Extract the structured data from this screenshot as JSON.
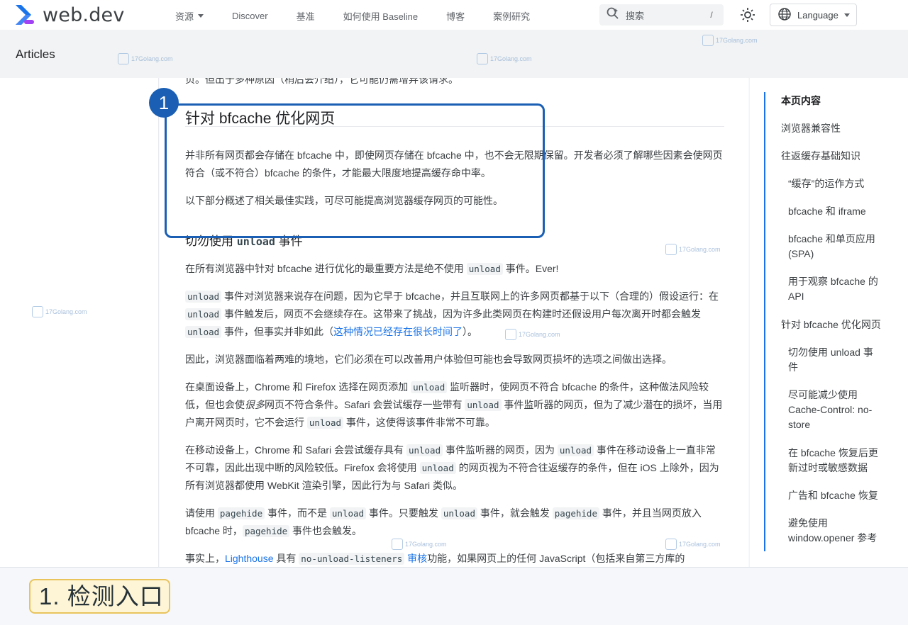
{
  "header": {
    "logo_text": "web.dev",
    "nav": [
      {
        "label": "资源",
        "has_dropdown": true
      },
      {
        "label": "Discover"
      },
      {
        "label": "基准"
      },
      {
        "label": "如何使用 Baseline"
      },
      {
        "label": "博客"
      },
      {
        "label": "案例研究"
      }
    ],
    "search_placeholder": "搜索",
    "search_shortcut": "/",
    "language_label": "Language"
  },
  "subheader": {
    "title": "Articles"
  },
  "watermark": "17Golang.com",
  "content": {
    "cutoff_line": "页。但出于多种原因（稍后会介绍），它可能仍需增弃该请求。",
    "section_title": "针对 bfcache 优化网页",
    "p1": "并非所有网页都会存储在 bfcache 中，即使网页存储在 bfcache 中，也不会无限期保留。开发者必须了解哪些因素会使网页符合（或不符合）bfcache 的条件，才能最大限度地提高缓存命中率。",
    "p2": "以下部分概述了相关最佳实践，可尽可能提高浏览器缓存网页的可能性。",
    "sub_title_pre": "切勿使用 ",
    "sub_title_code": "unload",
    "sub_title_post": " 事件",
    "p3_pre": "在所有浏览器中针对 bfcache 进行优化的最重要方法是绝不使用 ",
    "p3_code": "unload",
    "p3_post": " 事件。Ever!",
    "p4": {
      "c1": "unload",
      "t1": " 事件对浏览器来说存在问题，因为它早于 bfcache，并且互联网上的许多网页都基于以下（合理的）假设运行：在 ",
      "c2": "unload",
      "t2": " 事件触发后，网页不会继续存在。这带来了挑战，因为许多此类网页在构建时还假设用户每次离开时都会触发 ",
      "c3": "unload",
      "t3": " 事件，但事实并非如此（",
      "link": "这种情况已经存在很长时间了",
      "t4": "）。"
    },
    "p5": "因此，浏览器面临着两难的境地，它们必须在可以改善用户体验但可能也会导致网页损坏的选项之间做出选择。",
    "p6": {
      "t1": "在桌面设备上，Chrome 和 Firefox 选择在网页添加 ",
      "c1": "unload",
      "t2": " 监听器时，使网页不符合 bfcache 的条件，这种做法风险较低，但也会使",
      "em": "很多",
      "t3": "网页不符合条件。Safari 会尝试缓存一些带有 ",
      "c2": "unload",
      "t4": " 事件监听器的网页，但为了减少潜在的损坏，当用户离开网页时，它不会运行 ",
      "c3": "unload",
      "t5": " 事件，这使得该事件非常不可靠。"
    },
    "p7": {
      "t1": "在移动设备上，Chrome 和 Safari 会尝试缓存具有 ",
      "c1": "unload",
      "t2": " 事件监听器的网页，因为 ",
      "c2": "unload",
      "t3": " 事件在移动设备上一直非常不可靠，因此出现中断的风险较低。Firefox 会将使用 ",
      "c3": "unload",
      "t4": " 的网页视为不符合往返缓存的条件，但在 iOS 上除外，因为所有浏览器都使用 WebKit 渲染引擎，因此行为与 Safari 类似。"
    },
    "p8": {
      "t1": "请使用 ",
      "c1": "pagehide",
      "t2": " 事件，而不是 ",
      "c2": "unload",
      "t3": " 事件。只要触发 ",
      "c3": "unload",
      "t4": " 事件，就会触发 ",
      "c4": "pagehide",
      "t5": " 事件，并且当网页放入 bfcache 时，",
      "c5": "pagehide",
      "t6": " 事件也会触发。"
    },
    "p9": {
      "t1": "事实上，",
      "link1": "Lighthouse",
      "t2": " 具有 ",
      "c1": "no-unload-listeners",
      "link2": " 审核",
      "t3": "功能，如果网页上的任何 JavaScript（包括来自第三方库的"
    }
  },
  "highlight": {
    "number": "1"
  },
  "toc": [
    {
      "label": "本页内容",
      "head": true
    },
    {
      "label": "浏览器兼容性"
    },
    {
      "label": "往返缓存基础知识"
    },
    {
      "label": "“缓存”的运作方式",
      "indent": true
    },
    {
      "label": "bfcache 和 iframe",
      "indent": true
    },
    {
      "label": "bfcache 和单页应用 (SPA)",
      "indent": true
    },
    {
      "label": "用于观察 bfcache 的 API",
      "indent": true
    },
    {
      "label": "针对 bfcache 优化网页"
    },
    {
      "label": "切勿使用 unload 事件",
      "indent": true
    },
    {
      "label": "尽可能减少使用 Cache-Control: no-store",
      "indent": true
    },
    {
      "label": "在 bfcache 恢复后更新过时或敏感数据",
      "indent": true
    },
    {
      "label": "广告和 bfcache 恢复",
      "indent": true
    },
    {
      "label": "避免使用 window.opener 参考",
      "indent": true
    }
  ],
  "caption": "1. 检测入口",
  "colors": {
    "accent": "#1a5fb4",
    "link": "#1a73e8",
    "caption_bg": "#fdf5d6",
    "caption_border": "#e9c45d"
  }
}
